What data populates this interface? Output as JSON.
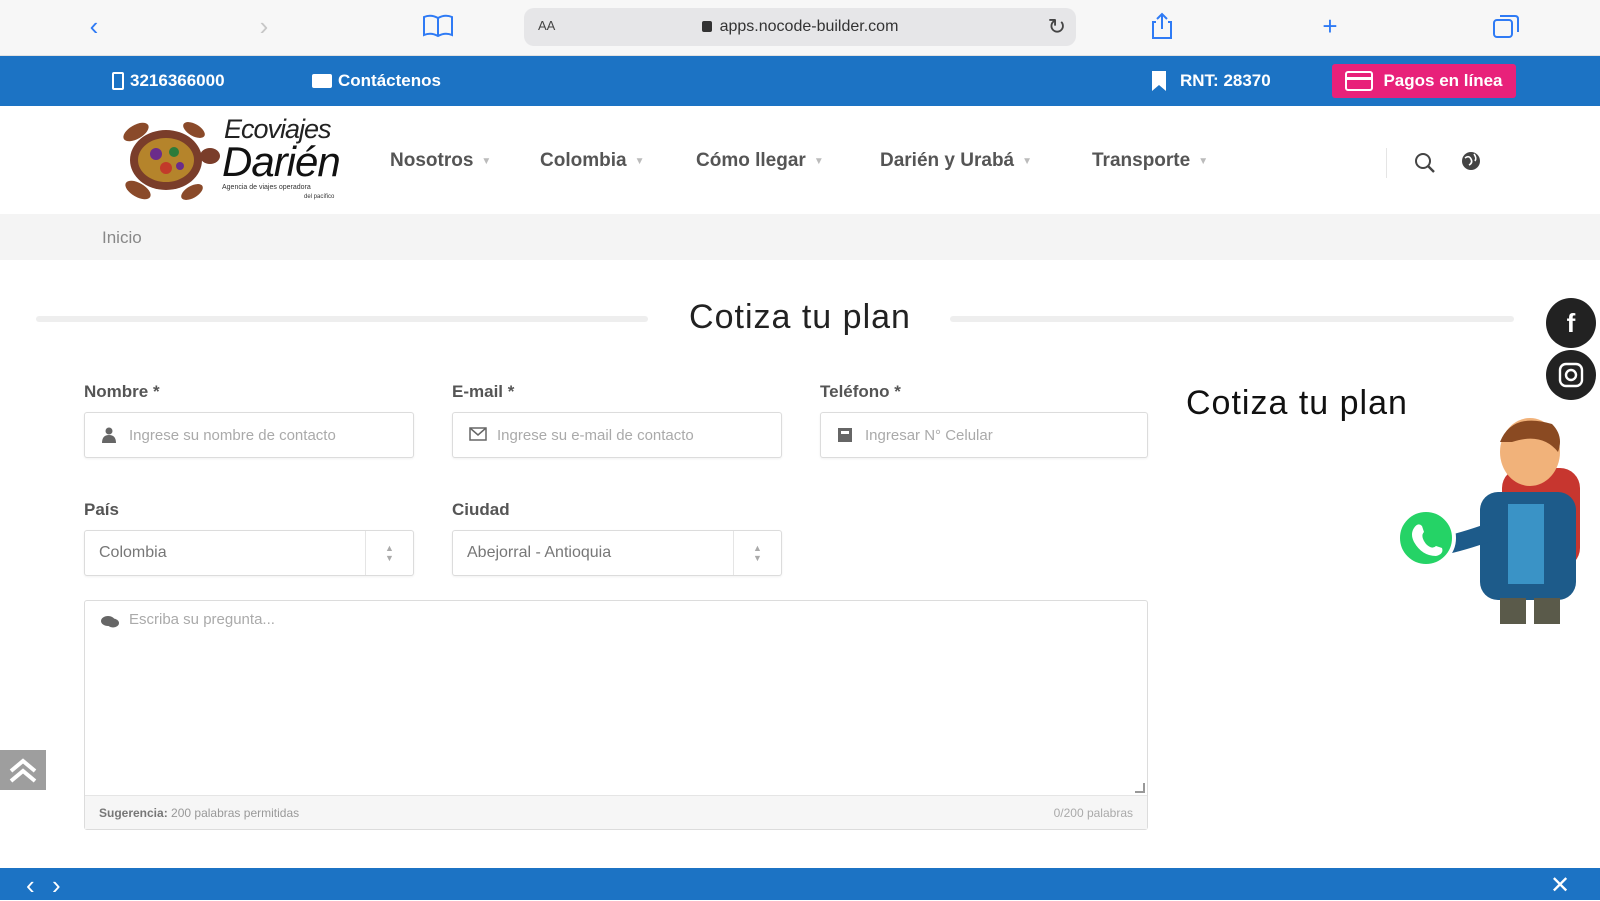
{
  "browser": {
    "url": "apps.nocode-builder.com",
    "text_size_label": "AA"
  },
  "topbar": {
    "phone": "3216366000",
    "contact": "Contáctenos",
    "rnt": "RNT: 28370",
    "pay_label": "Pagos en línea"
  },
  "logo": {
    "line1": "Ecoviajes",
    "line2": "Darién",
    "tagline": "Agencia de viajes operadora",
    "tagline2": "del pacífico"
  },
  "nav": {
    "items": [
      {
        "label": "Nosotros"
      },
      {
        "label": "Colombia"
      },
      {
        "label": "Cómo llegar"
      },
      {
        "label": "Darién y Urabá"
      },
      {
        "label": "Transporte"
      }
    ]
  },
  "breadcrumb": {
    "home": "Inicio"
  },
  "section": {
    "title": "Cotiza tu plan"
  },
  "form": {
    "name_label": "Nombre *",
    "name_placeholder": "Ingrese su nombre de contacto",
    "email_label": "E-mail *",
    "email_placeholder": "Ingrese su e-mail de contacto",
    "phone_label": "Teléfono *",
    "phone_placeholder": "Ingresar N° Celular",
    "country_label": "País",
    "country_value": "Colombia",
    "city_label": "Ciudad",
    "city_value": "Abejorral - Antioquia",
    "question_placeholder": "Escriba su pregunta...",
    "hint_label": "Sugerencia:",
    "hint_text": "200 palabras permitidas",
    "word_count": "0/200 palabras"
  },
  "promo": {
    "title": "Cotiza tu plan"
  },
  "colors": {
    "brand_blue": "#1c73c4",
    "pay_pink": "#e8217a",
    "whatsapp_green": "#25d366"
  }
}
